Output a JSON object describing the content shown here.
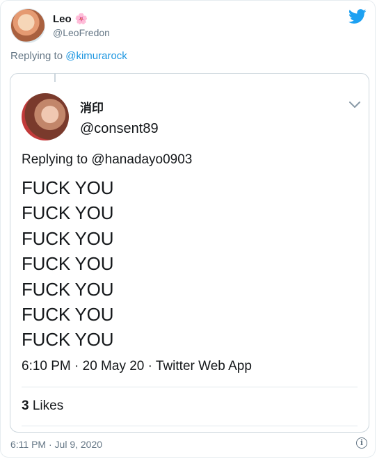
{
  "tweet": {
    "author_name": "Leo",
    "author_emoji": "🌸",
    "author_handle": "@LeoFredon",
    "replying_prefix": "Replying to ",
    "replying_handle": "@kimurarock",
    "timestamp": "6:11 PM · Jul 9, 2020",
    "info_icon": "i"
  },
  "quoted": {
    "author_name": "消印",
    "author_handle": "@consent89",
    "replying_prefix": "Replying to ",
    "replying_handle": "@hanadayo0903",
    "lines": [
      "FUCK YOU",
      "FUCK YOU",
      "FUCK YOU",
      "FUCK YOU",
      "FUCK YOU",
      "FUCK YOU",
      "FUCK YOU"
    ],
    "meta": "6:10 PM · 20 May 20 · Twitter Web App",
    "likes_count": "3",
    "likes_label": " Likes"
  },
  "colors": {
    "twitter_blue": "#1da1f2",
    "link_blue": "#1b95e0",
    "muted_gray": "#657786"
  },
  "icons": [
    "twitter-bird-icon",
    "chevron-down-icon",
    "info-icon",
    "flower-icon"
  ]
}
